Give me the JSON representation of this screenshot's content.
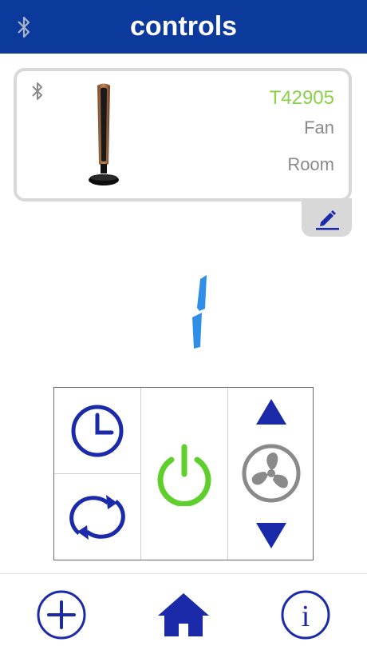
{
  "header": {
    "title": "controls",
    "bluetooth_icon": "bluetooth-icon"
  },
  "device": {
    "model": "T42905",
    "type": "Fan",
    "room": "Room",
    "status_icon": "bluetooth-icon",
    "image": "tower-fan-image",
    "edit_icon": "pencil-icon"
  },
  "speed": {
    "value": "1"
  },
  "controls": {
    "timer_icon": "clock-icon",
    "oscillate_icon": "oscillate-icon",
    "power_icon": "power-icon",
    "speed_up_icon": "triangle-up-icon",
    "fan_mode_icon": "fan-icon",
    "speed_down_icon": "triangle-down-icon"
  },
  "nav": {
    "add_icon": "plus-circle-icon",
    "home_icon": "home-icon",
    "info_icon": "info-icon",
    "info_glyph": "i"
  },
  "colors": {
    "brand": "#0b3a9c",
    "accent_green": "#8ad04a",
    "power_green": "#5fcf2b",
    "control_blue": "#1a2aa8",
    "digit_blue": "#2f8fe8",
    "muted_gray": "#8a8a8a"
  }
}
